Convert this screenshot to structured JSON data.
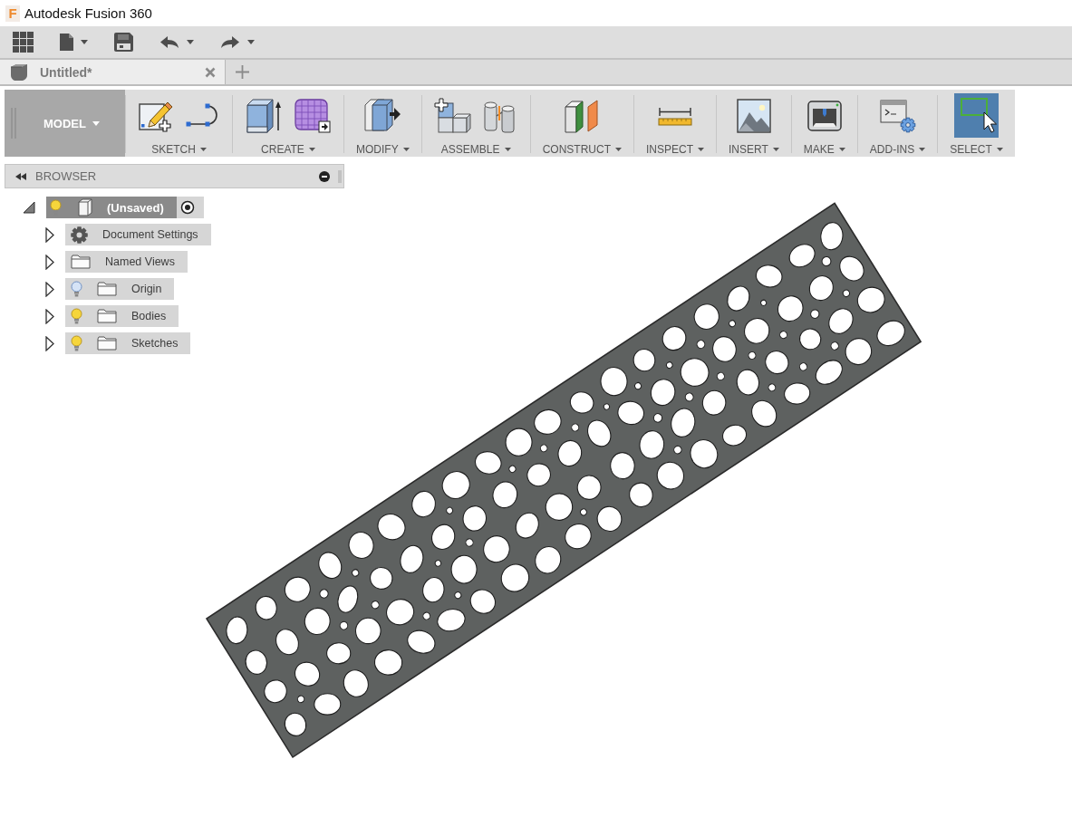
{
  "window": {
    "logo": "F",
    "title": "Autodesk Fusion 360"
  },
  "quick_access_toolbar": [
    {
      "kind": "apps",
      "dropdown": false
    },
    {
      "kind": "file",
      "dropdown": true
    },
    {
      "kind": "save",
      "dropdown": false
    },
    {
      "kind": "undo",
      "dropdown": true
    },
    {
      "kind": "redo",
      "dropdown": true
    }
  ],
  "document_tabs": [
    {
      "title": "Untitled*",
      "selected": true
    }
  ],
  "workspace_switcher": {
    "label": "MODEL"
  },
  "toolbar_groups": [
    {
      "kind": "sketch",
      "label": "SKETCH",
      "selected": false
    },
    {
      "kind": "create",
      "label": "CREATE",
      "selected": false
    },
    {
      "kind": "modify",
      "label": "MODIFY",
      "selected": false
    },
    {
      "kind": "assemble",
      "label": "ASSEMBLE",
      "selected": false
    },
    {
      "kind": "construct",
      "label": "CONSTRUCT",
      "selected": false
    },
    {
      "kind": "inspect",
      "label": "INSPECT",
      "selected": false
    },
    {
      "kind": "insert",
      "label": "INSERT",
      "selected": false
    },
    {
      "kind": "make",
      "label": "MAKE",
      "selected": false
    },
    {
      "kind": "addins",
      "label": "ADD-INS",
      "selected": false
    },
    {
      "kind": "select",
      "label": "SELECT",
      "selected": true
    }
  ],
  "browser": {
    "title": "BROWSER",
    "root": {
      "kind": "component",
      "label": "(Unsaved)",
      "expanded": true,
      "visible": true,
      "active": true,
      "children": [
        {
          "kind": "settings",
          "label": "Document Settings",
          "expanded": false
        },
        {
          "kind": "folder",
          "label": "Named Views",
          "expanded": false
        },
        {
          "kind": "folder",
          "label": "Origin",
          "expanded": false,
          "visible": false
        },
        {
          "kind": "folder",
          "label": "Bodies",
          "expanded": false,
          "visible": true
        },
        {
          "kind": "folder",
          "label": "Sketches",
          "expanded": false,
          "visible": true
        }
      ]
    }
  }
}
